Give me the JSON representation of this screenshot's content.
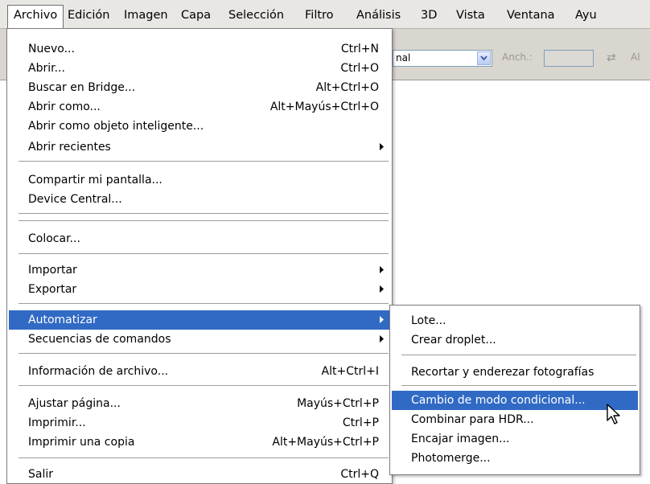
{
  "menubar": {
    "items": [
      {
        "label": "Archivo",
        "active": true
      },
      {
        "label": "Edición"
      },
      {
        "label": "Imagen"
      },
      {
        "label": "Capa"
      },
      {
        "label": "Selección"
      },
      {
        "label": "Filtro"
      },
      {
        "label": "Análisis"
      },
      {
        "label": "3D"
      },
      {
        "label": "Vista"
      },
      {
        "label": "Ventana"
      },
      {
        "label": "Ayu"
      }
    ]
  },
  "optionsbar": {
    "style_value": "nal",
    "width_label": "Anch.:",
    "height_label": "Al"
  },
  "file_menu": {
    "items": [
      {
        "label": "Nuevo...",
        "shortcut": "Ctrl+N"
      },
      {
        "label": "Abrir...",
        "shortcut": "Ctrl+O"
      },
      {
        "label": "Buscar en Bridge...",
        "shortcut": "Alt+Ctrl+O"
      },
      {
        "label": "Abrir como...",
        "shortcut": "Alt+Mayús+Ctrl+O"
      },
      {
        "label": "Abrir como objeto inteligente...",
        "shortcut": ""
      },
      {
        "label": "Abrir recientes",
        "shortcut": "",
        "submenu": true
      },
      {
        "label": "Compartir mi pantalla...",
        "shortcut": ""
      },
      {
        "label": "Device Central...",
        "shortcut": ""
      },
      {
        "label": "Colocar...",
        "shortcut": ""
      },
      {
        "label": "Importar",
        "shortcut": "",
        "submenu": true
      },
      {
        "label": "Exportar",
        "shortcut": "",
        "submenu": true
      },
      {
        "label": "Automatizar",
        "shortcut": "",
        "submenu": true,
        "highlighted": true
      },
      {
        "label": "Secuencias de comandos",
        "shortcut": "",
        "submenu": true
      },
      {
        "label": "Información de archivo...",
        "shortcut": "Alt+Ctrl+I"
      },
      {
        "label": "Ajustar página...",
        "shortcut": "Mayús+Ctrl+P"
      },
      {
        "label": "Imprimir...",
        "shortcut": "Ctrl+P"
      },
      {
        "label": "Imprimir una copia",
        "shortcut": "Alt+Mayús+Ctrl+P"
      },
      {
        "label": "Salir",
        "shortcut": "Ctrl+Q"
      }
    ]
  },
  "automate_menu": {
    "items": [
      {
        "label": "Lote..."
      },
      {
        "label": "Crear droplet..."
      },
      {
        "label": "Recortar y enderezar fotografías"
      },
      {
        "label": "Cambio de modo condicional...",
        "highlighted": true
      },
      {
        "label": "Combinar para HDR..."
      },
      {
        "label": "Encajar imagen..."
      },
      {
        "label": "Photomerge..."
      }
    ]
  },
  "colors": {
    "highlight": "#316ac5",
    "menubar_bg": "#e9e7e3",
    "menu_bg": "#ffffff"
  }
}
